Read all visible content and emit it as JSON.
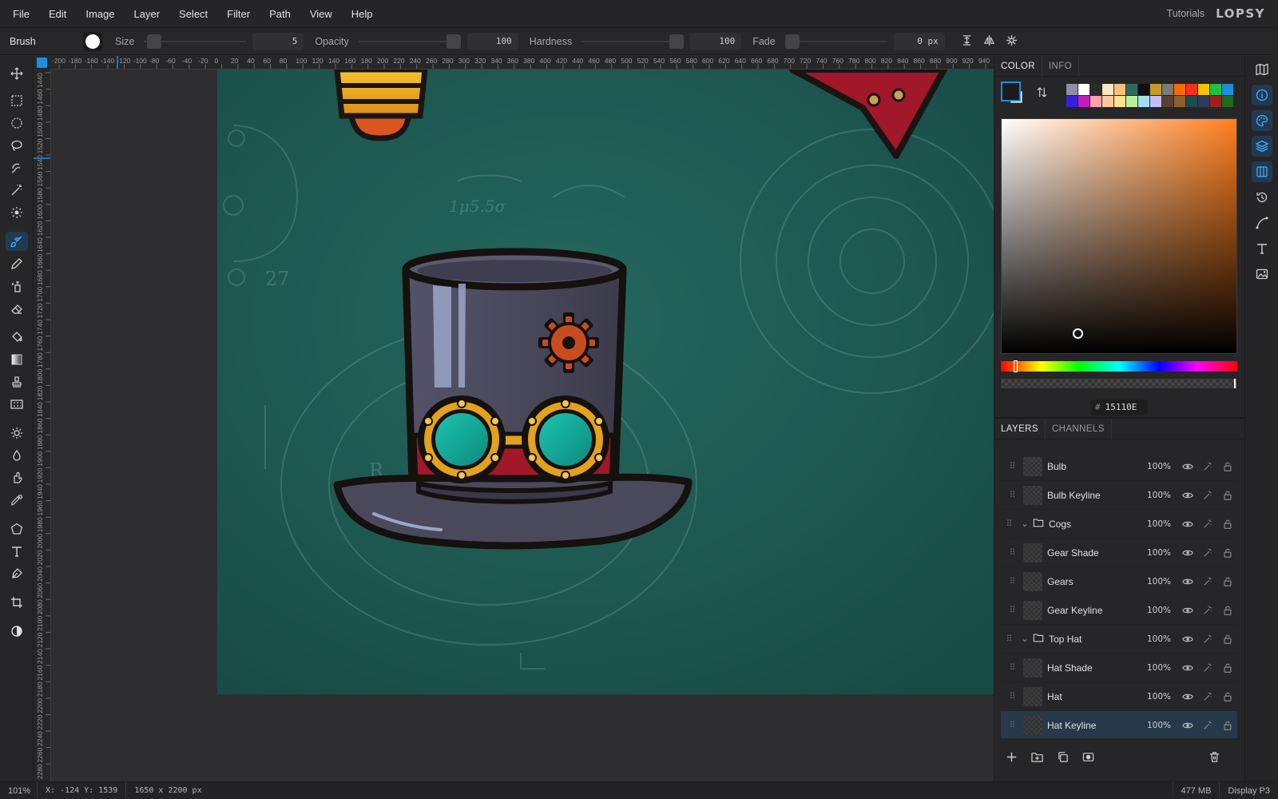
{
  "menu": [
    "File",
    "Edit",
    "Image",
    "Layer",
    "Select",
    "Filter",
    "Path",
    "View",
    "Help"
  ],
  "header": {
    "tutorials": "Tutorials",
    "logo": "LOPSY"
  },
  "options": {
    "tool": "Brush",
    "size_label": "Size",
    "size_value": "5",
    "size_fraction": 0.03,
    "opacity_label": "Opacity",
    "opacity_value": "100",
    "opacity_fraction": 1.0,
    "hardness_label": "Hardness",
    "hardness_value": "100",
    "hardness_fraction": 1.0,
    "fade_label": "Fade",
    "fade_value": "0 px",
    "fade_fraction": 0.0
  },
  "tools": [
    "move-icon",
    "marquee-rect-icon",
    "marquee-ellipse-icon",
    "lasso-icon",
    "object-select-icon",
    "magic-wand-icon",
    "healing-icon",
    "brush-icon",
    "pencil-icon",
    "clone-icon",
    "eraser-icon",
    "bucket-icon",
    "gradient-icon",
    "stamp-icon",
    "pattern-icon",
    "dodge-icon",
    "blur-icon",
    "smudge-icon",
    "pipette-icon",
    "shape-icon",
    "type-icon",
    "pen-icon",
    "crop-icon",
    "contrast-icon"
  ],
  "ruler": {
    "top": [
      "-200",
      "-180",
      "-160",
      "-140",
      "-120",
      "-100",
      "-80",
      "-60",
      "-40",
      "-20",
      "0",
      "20",
      "40",
      "60",
      "80",
      "100",
      "120",
      "140",
      "160",
      "180",
      "200",
      "220",
      "240",
      "260",
      "280",
      "300",
      "320",
      "340",
      "360",
      "380",
      "400",
      "420",
      "440",
      "460",
      "480",
      "500",
      "520",
      "540",
      "560",
      "580",
      "600",
      "620",
      "640",
      "660",
      "680",
      "700",
      "720",
      "740",
      "760",
      "780",
      "800",
      "820",
      "840",
      "860",
      "880",
      "900",
      "920",
      "940"
    ],
    "left": [
      "1440",
      "1460",
      "1480",
      "1500",
      "1520",
      "1540",
      "1560",
      "1580",
      "1600",
      "1620",
      "1640",
      "1660",
      "1680",
      "1700",
      "1720",
      "1740",
      "1760",
      "1780",
      "1800",
      "1820",
      "1840",
      "1860",
      "1880",
      "1900",
      "1920",
      "1940",
      "1960",
      "1980",
      "2000",
      "2020",
      "2040",
      "2060",
      "2080",
      "2100",
      "2120",
      "2140",
      "2160",
      "2180",
      "2200",
      "2220",
      "2240",
      "2260",
      "2280"
    ]
  },
  "color_panel": {
    "tabs": [
      "COLOR",
      "INFO"
    ],
    "swatches": [
      "#8b8fa8",
      "#ffffff",
      "#2b2b2b",
      "#f7e7c4",
      "#f4c17a",
      "#2f6b5b",
      "#111111",
      "#c49a2a",
      "#7a7a7a",
      "#ff6a00",
      "#ff2d1e",
      "#f7c400",
      "#20c040",
      "#1b8ee0",
      "#3a1ee0",
      "#c01ec0",
      "#ff9fb0",
      "#ffc9a0",
      "#ffe38a",
      "#b8f0a0",
      "#a0e0f0",
      "#c0c0ff",
      "#5a4030",
      "#8a6030",
      "#1e4a4a",
      "#2e3a60",
      "#a01e1e",
      "#1e6a1e"
    ],
    "hex_prefix": "#",
    "hex": "15110E",
    "hue_fraction": 0.06,
    "saturation": 0.32,
    "brightness": 0.09
  },
  "layers_panel": {
    "tabs": [
      "LAYERS",
      "CHANNELS"
    ],
    "layers": [
      {
        "name": "Bulb",
        "opacity": "100%",
        "type": "layer",
        "selected": false
      },
      {
        "name": "Bulb Keyline",
        "opacity": "100%",
        "type": "layer",
        "selected": false
      },
      {
        "name": "Cogs",
        "opacity": "100%",
        "type": "group",
        "selected": false
      },
      {
        "name": "Gear Shade",
        "opacity": "100%",
        "type": "layer",
        "selected": false
      },
      {
        "name": "Gears",
        "opacity": "100%",
        "type": "layer",
        "selected": false
      },
      {
        "name": "Gear Keyline",
        "opacity": "100%",
        "type": "layer",
        "selected": false
      },
      {
        "name": "Top Hat",
        "opacity": "100%",
        "type": "group",
        "selected": false
      },
      {
        "name": "Hat Shade",
        "opacity": "100%",
        "type": "layer",
        "selected": false
      },
      {
        "name": "Hat",
        "opacity": "100%",
        "type": "layer",
        "selected": false
      },
      {
        "name": "Hat Keyline",
        "opacity": "100%",
        "type": "layer",
        "selected": true
      }
    ]
  },
  "dock": [
    "map-icon",
    "info-icon",
    "palette-icon",
    "layers-icon",
    "channels-icon",
    "history-icon",
    "path-icon",
    "type-icon",
    "image-icon"
  ],
  "canvas_text": {
    "grid_label": "27",
    "sketch_letter": "R",
    "sketch_note": "1μ5.5σ"
  },
  "status": {
    "zoom": "101%",
    "coords": "X: -124  Y: 1539",
    "dims": "1650 x 2200 px",
    "memory": "477 MB",
    "profile": "Display P3"
  },
  "colors": {
    "accent": "#1c8ee0",
    "canvas_bg": "#1f5a52",
    "hat": "#474657",
    "hat_band": "#a0182a",
    "goggle_lens": "#13a595",
    "goggle_rim": "#e2a21c",
    "gear": "#c94c20"
  }
}
